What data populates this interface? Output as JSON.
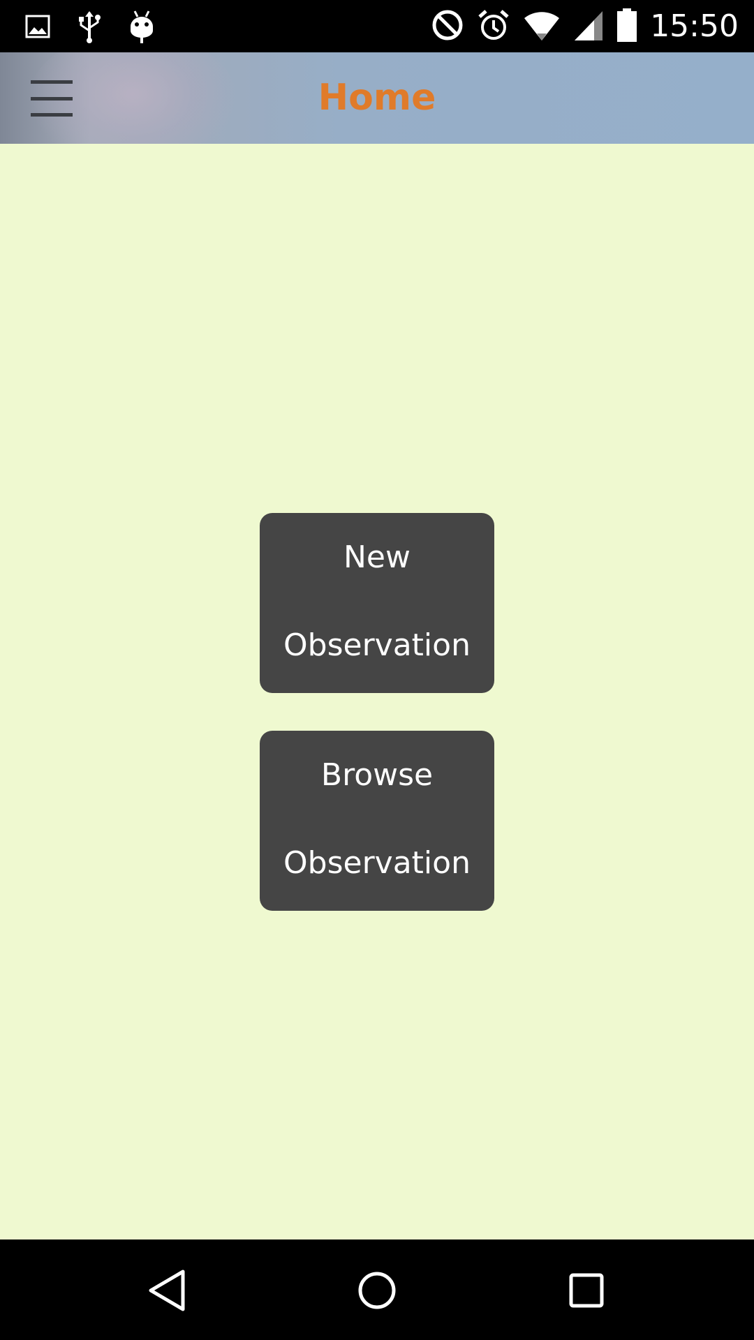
{
  "status_bar": {
    "time": "15:50",
    "left_icons": [
      "image-icon",
      "usb-icon",
      "android-debug-icon"
    ],
    "right_icons": [
      "do-not-disturb-icon",
      "alarm-icon",
      "wifi-icon",
      "signal-icon",
      "battery-icon"
    ]
  },
  "app_bar": {
    "menu_icon": "hamburger-menu-icon",
    "title": "Home",
    "title_color": "#E07B2A"
  },
  "main": {
    "background_color": "#EFF9D0",
    "buttons": [
      {
        "line1": "New",
        "line2": "Observation"
      },
      {
        "line1": "Browse",
        "line2": "Observation"
      }
    ]
  },
  "nav_bar": {
    "icons": [
      "back-icon",
      "home-icon",
      "recents-icon"
    ]
  }
}
